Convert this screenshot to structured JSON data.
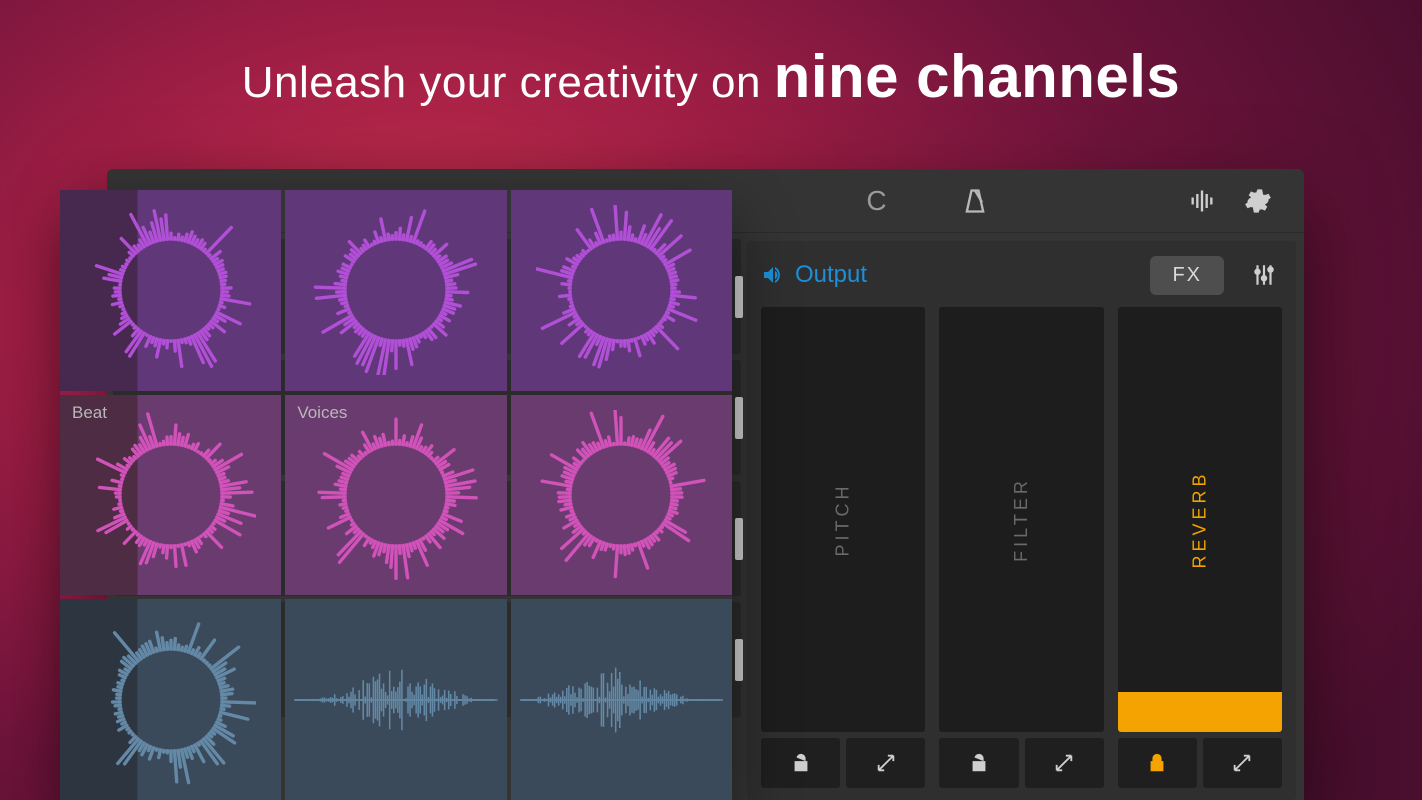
{
  "headline": {
    "pre": "Unleash your creativity on ",
    "bold": "nine channels"
  },
  "toolbar": {
    "key": "C"
  },
  "output": {
    "label": "Output",
    "fx_button": "FX"
  },
  "pads": {
    "r2c1_label": "Beat",
    "r2c2_label": "Voices"
  },
  "fx": [
    {
      "label": "PITCH",
      "active": false,
      "locked": false,
      "level": 0
    },
    {
      "label": "FILTER",
      "active": false,
      "locked": false,
      "level": 0
    },
    {
      "label": "REVERB",
      "active": true,
      "locked": true,
      "level": 12
    }
  ]
}
